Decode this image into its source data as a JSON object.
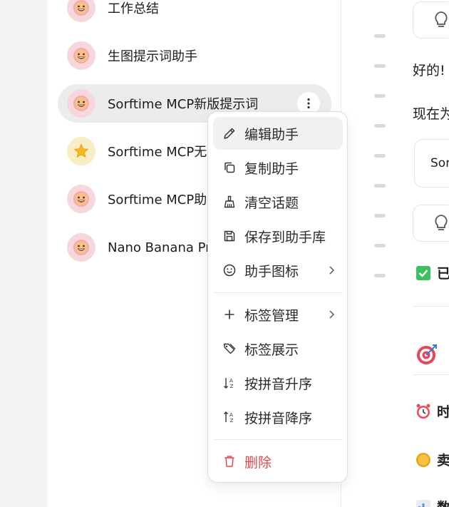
{
  "assistants": [
    {
      "name": "工作总结",
      "avatar": "grin-face-icon",
      "avatar_bg": "#f6d8dc"
    },
    {
      "name": "生图提示词助手",
      "avatar": "grin-face-icon",
      "avatar_bg": "#f6d8dc"
    },
    {
      "name": "Sorftime MCP新版提示词",
      "avatar": "grin-face-icon",
      "avatar_bg": "#f6d8dc",
      "active": true
    },
    {
      "name": "Sorftime MCP无",
      "avatar": "star-icon",
      "avatar_bg": "#f8edc5"
    },
    {
      "name": "Sorftime MCP助",
      "avatar": "grin-face-icon",
      "avatar_bg": "#f6d8dc"
    },
    {
      "name": "Nano Banana Pr",
      "avatar": "grin-face-icon",
      "avatar_bg": "#f6d8dc"
    }
  ],
  "context_menu": {
    "items": [
      {
        "label": "编辑助手",
        "icon": "pencil-icon"
      },
      {
        "label": "复制助手",
        "icon": "copy-icon"
      },
      {
        "label": "清空话题",
        "icon": "broom-icon"
      },
      {
        "label": "保存到助手库",
        "icon": "save-icon"
      },
      {
        "label": "助手图标",
        "icon": "smile-icon",
        "submenu": true
      },
      {
        "label": "标签管理",
        "icon": "plus-icon",
        "submenu": true
      },
      {
        "label": "标签展示",
        "icon": "tags-icon"
      },
      {
        "label": "按拼音升序",
        "icon": "sort-ascending-icon"
      },
      {
        "label": "按拼音降序",
        "icon": "sort-descending-icon"
      },
      {
        "label": "删除",
        "icon": "trash-icon",
        "danger": true
      }
    ]
  },
  "chat": {
    "line1": "好的!",
    "line2": "现在为",
    "card_text": "Sor",
    "checked_text": "已",
    "row_clock": "时",
    "row_coin": "卖",
    "row_chart": "数"
  },
  "colors": {
    "accent_danger": "#e5484d",
    "active_bg": "#ececee",
    "rail_bg": "#f3f3f5"
  }
}
